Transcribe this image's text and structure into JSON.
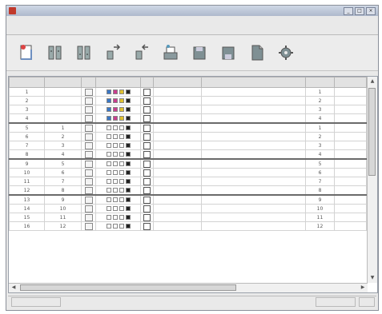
{
  "window": {
    "title": "",
    "controls": [
      "_",
      "□",
      "×"
    ]
  },
  "menu": {
    "row1": [
      "",
      "",
      "",
      "",
      "",
      "",
      ""
    ],
    "row2": [
      "",
      ""
    ],
    "right": [
      "",
      ""
    ]
  },
  "toolbar": {
    "icons": [
      "new-document-icon",
      "layout-icon",
      "layout-icon",
      "move-icon",
      "move-icon",
      "print-icon",
      "save-icon",
      "save-icon",
      "export-icon",
      "settings-icon"
    ]
  },
  "table": {
    "headers": [
      "",
      "",
      "",
      "",
      "",
      "",
      "",
      "",
      ""
    ],
    "rows": [
      {
        "no": "1",
        "name": "",
        "swatches": [
          "#3b77c4",
          "#c93d8f",
          "#e0c12f",
          "#222222"
        ],
        "template": "",
        "file": "",
        "page": "1"
      },
      {
        "no": "2",
        "name": "",
        "swatches": [
          "#3b77c4",
          "#c93d8f",
          "#e0c12f",
          "#222222"
        ],
        "template": "",
        "file": "",
        "page": "2"
      },
      {
        "no": "3",
        "name": "",
        "swatches": [
          "#3b77c4",
          "#c93d8f",
          "#e0c12f",
          "#222222"
        ],
        "template": "",
        "file": "",
        "page": "3"
      },
      {
        "no": "4",
        "name": "",
        "swatches": [
          "#3b77c4",
          "#c93d8f",
          "#e0c12f",
          "#222222"
        ],
        "template": "",
        "file": "",
        "page": "4"
      },
      {
        "no": "5",
        "name": "1",
        "swatches": [
          "#ffffff",
          "#ffffff",
          "#ffffff",
          "#222222"
        ],
        "template": "",
        "file": "",
        "page": "1",
        "sep": true
      },
      {
        "no": "6",
        "name": "2",
        "swatches": [
          "#ffffff",
          "#ffffff",
          "#ffffff",
          "#222222"
        ],
        "template": "",
        "file": "",
        "page": "2"
      },
      {
        "no": "7",
        "name": "3",
        "swatches": [
          "#ffffff",
          "#ffffff",
          "#ffffff",
          "#222222"
        ],
        "template": "",
        "file": "",
        "page": "3"
      },
      {
        "no": "8",
        "name": "4",
        "swatches": [
          "#ffffff",
          "#ffffff",
          "#ffffff",
          "#222222"
        ],
        "template": "",
        "file": "",
        "page": "4"
      },
      {
        "no": "9",
        "name": "5",
        "swatches": [
          "#ffffff",
          "#ffffff",
          "#ffffff",
          "#222222"
        ],
        "template": "",
        "file": "",
        "page": "5",
        "sep": true
      },
      {
        "no": "10",
        "name": "6",
        "swatches": [
          "#ffffff",
          "#ffffff",
          "#ffffff",
          "#222222"
        ],
        "template": "",
        "file": "",
        "page": "6"
      },
      {
        "no": "11",
        "name": "7",
        "swatches": [
          "#ffffff",
          "#ffffff",
          "#ffffff",
          "#222222"
        ],
        "template": "",
        "file": "",
        "page": "7"
      },
      {
        "no": "12",
        "name": "8",
        "swatches": [
          "#ffffff",
          "#ffffff",
          "#ffffff",
          "#222222"
        ],
        "template": "",
        "file": "",
        "page": "8"
      },
      {
        "no": "13",
        "name": "9",
        "swatches": [
          "#ffffff",
          "#ffffff",
          "#ffffff",
          "#222222"
        ],
        "template": "",
        "file": "",
        "page": "9",
        "sep": true
      },
      {
        "no": "14",
        "name": "10",
        "swatches": [
          "#ffffff",
          "#ffffff",
          "#ffffff",
          "#222222"
        ],
        "template": "",
        "file": "",
        "page": "10"
      },
      {
        "no": "15",
        "name": "11",
        "swatches": [
          "#ffffff",
          "#ffffff",
          "#ffffff",
          "#222222"
        ],
        "template": "",
        "file": "",
        "page": "11"
      },
      {
        "no": "16",
        "name": "12",
        "swatches": [
          "#ffffff",
          "#ffffff",
          "#ffffff",
          "#222222"
        ],
        "template": "",
        "file": "",
        "page": "12"
      }
    ]
  },
  "status": {
    "left": "",
    "right": ""
  }
}
